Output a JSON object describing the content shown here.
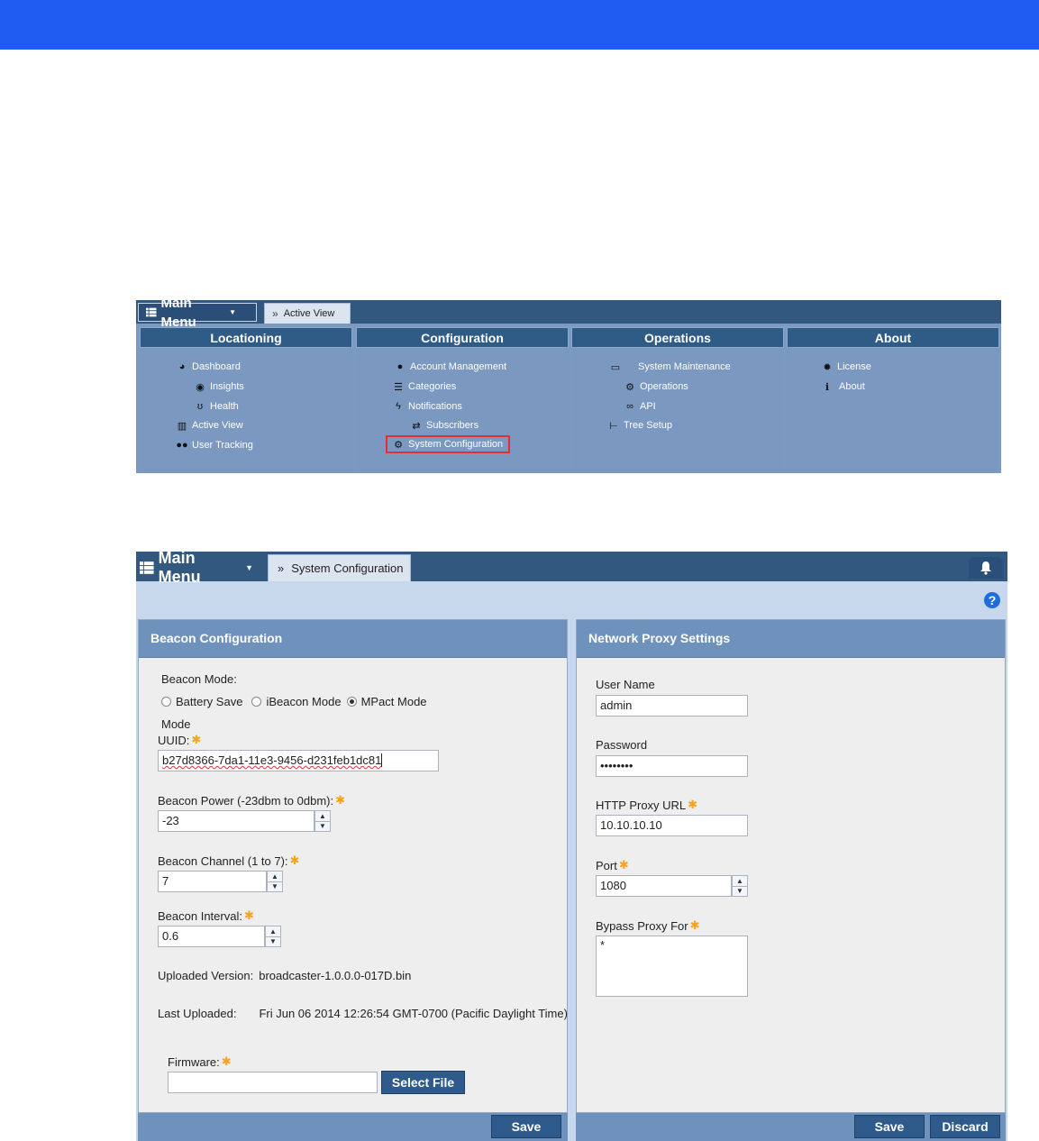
{
  "menu": {
    "main_menu_label": "Main Menu",
    "active_tab_label": "Active View",
    "columns": [
      {
        "title": "Locationing",
        "items": [
          {
            "label": "Dashboard",
            "icon": "dashboard-icon"
          },
          {
            "label": "Insights",
            "icon": "eye-icon"
          },
          {
            "label": "Health",
            "icon": "stethoscope-icon"
          },
          {
            "label": "Active View",
            "icon": "bar-chart-icon"
          },
          {
            "label": "User Tracking",
            "icon": "users-icon"
          }
        ]
      },
      {
        "title": "Configuration",
        "items": [
          {
            "label": "Account Management",
            "icon": "user-key-icon"
          },
          {
            "label": "Categories",
            "icon": "list-icon"
          },
          {
            "label": "Notifications",
            "icon": "lightning-icon"
          },
          {
            "label": "Subscribers",
            "icon": "arrows-exchange-icon"
          },
          {
            "label": "System Configuration",
            "icon": "gears-icon",
            "highlighted": true
          }
        ]
      },
      {
        "title": "Operations",
        "items": [
          {
            "label": "System Maintenance",
            "icon": "monitor-gear-icon"
          },
          {
            "label": "Operations",
            "icon": "gears-icon"
          },
          {
            "label": "API",
            "icon": "link-icon"
          },
          {
            "label": "Tree Setup",
            "icon": "tree-icon"
          }
        ]
      },
      {
        "title": "About",
        "items": [
          {
            "label": "License",
            "icon": "badge-icon"
          },
          {
            "label": "About",
            "icon": "info-icon"
          }
        ]
      }
    ]
  },
  "sysconfig": {
    "main_menu_label": "Main Menu",
    "active_tab_label": "System Configuration",
    "help_glyph": "?",
    "beacon": {
      "title": "Beacon Configuration",
      "mode_label": "Beacon Mode:",
      "mode_options": [
        "Battery Save",
        "iBeacon Mode",
        "MPact Mode"
      ],
      "mode_selected": "MPact Mode",
      "mode_wrap_label": "Mode",
      "uuid_label": "UUID:",
      "uuid_value": "b27d8366-7da1-11e3-9456-d231feb1dc81",
      "power_label": "Beacon Power (-23dbm to 0dbm):",
      "power_value": "-23",
      "channel_label": "Beacon Channel (1 to 7):",
      "channel_value": "7",
      "interval_label": "Beacon Interval:",
      "interval_value": "0.6",
      "uploaded_version_label": "Uploaded Version:",
      "uploaded_version_value": "broadcaster-1.0.0.0-017D.bin",
      "last_uploaded_label": "Last Uploaded:",
      "last_uploaded_value": "Fri Jun 06 2014 12:26:54 GMT-0700 (Pacific Daylight Time)",
      "firmware_label": "Firmware:",
      "firmware_value": "",
      "select_file_label": "Select File",
      "save_label": "Save"
    },
    "proxy": {
      "title": "Network Proxy Settings",
      "username_label": "User Name",
      "username_value": "admin",
      "password_label": "Password",
      "password_value": "••••••••",
      "http_proxy_label": "HTTP Proxy URL",
      "http_proxy_value": "10.10.10.10",
      "port_label": "Port",
      "port_value": "1080",
      "bypass_label": "Bypass Proxy For",
      "bypass_value": "*",
      "save_label": "Save",
      "discard_label": "Discard"
    },
    "required_marker": "✱"
  },
  "colors": {
    "top_bar": "#1f5cf2",
    "header_dark": "#33587f",
    "panel_header": "#6f92bd",
    "required_star": "#f4a31a",
    "highlight_box": "#e03030"
  }
}
